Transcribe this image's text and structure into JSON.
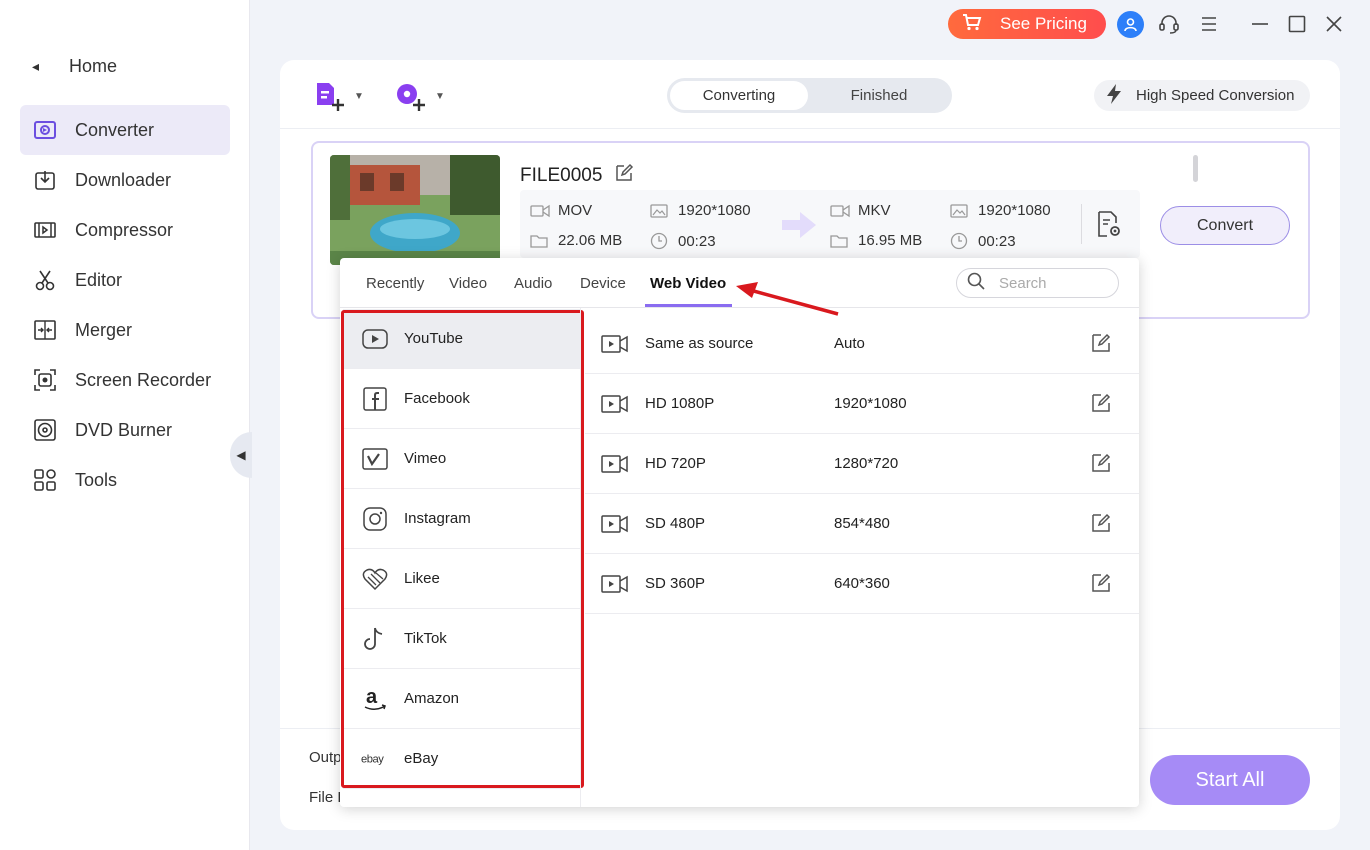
{
  "window": {
    "pricing_label": "See Pricing"
  },
  "sidebar": {
    "home_label": "Home",
    "items": [
      {
        "label": "Converter",
        "active": true
      },
      {
        "label": "Downloader"
      },
      {
        "label": "Compressor"
      },
      {
        "label": "Editor"
      },
      {
        "label": "Merger"
      },
      {
        "label": "Screen Recorder"
      },
      {
        "label": "DVD Burner"
      },
      {
        "label": "Tools"
      }
    ]
  },
  "toolbar": {
    "tabs": [
      {
        "label": "Converting",
        "active": true
      },
      {
        "label": "Finished"
      }
    ],
    "high_speed_label": "High Speed Conversion"
  },
  "file": {
    "name": "FILE0005",
    "source": {
      "format": "MOV",
      "resolution": "1920*1080",
      "size": "22.06 MB",
      "duration": "00:23"
    },
    "target": {
      "format": "MKV",
      "resolution": "1920*1080",
      "size": "16.95 MB",
      "duration": "00:23"
    },
    "convert_label": "Convert"
  },
  "bottom": {
    "output_label": "Outp",
    "file_location_label": "File L",
    "start_all_label": "Start All"
  },
  "format_dropdown": {
    "tabs": [
      "Recently",
      "Video",
      "Audio",
      "Device",
      "Web Video"
    ],
    "active_tab": "Web Video",
    "search_placeholder": "Search",
    "platforms": [
      {
        "label": "YouTube",
        "icon": "youtube-icon",
        "selected": true
      },
      {
        "label": "Facebook",
        "icon": "facebook-icon"
      },
      {
        "label": "Vimeo",
        "icon": "vimeo-icon"
      },
      {
        "label": "Instagram",
        "icon": "instagram-icon"
      },
      {
        "label": "Likee",
        "icon": "likee-icon"
      },
      {
        "label": "TikTok",
        "icon": "tiktok-icon"
      },
      {
        "label": "Amazon",
        "icon": "amazon-icon"
      },
      {
        "label": "eBay",
        "icon": "ebay-icon"
      }
    ],
    "resolutions": [
      {
        "name": "Same as source",
        "value": "Auto"
      },
      {
        "name": "HD 1080P",
        "value": "1920*1080"
      },
      {
        "name": "HD 720P",
        "value": "1280*720"
      },
      {
        "name": "SD 480P",
        "value": "854*480"
      },
      {
        "name": "SD 360P",
        "value": "640*360"
      }
    ]
  },
  "colors": {
    "accent": "#8a6cf0",
    "start_all": "#a68bf6",
    "pricing": "#ff5a45",
    "highlight_box": "#d9191e"
  }
}
